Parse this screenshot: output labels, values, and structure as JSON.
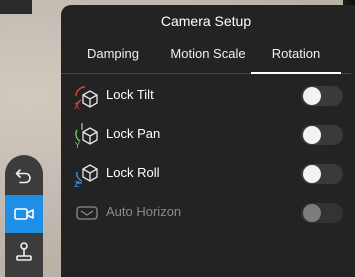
{
  "panel": {
    "title": "Camera Setup",
    "tabs": [
      {
        "label": "Damping",
        "selected": false
      },
      {
        "label": "Motion Scale",
        "selected": false
      },
      {
        "label": "Rotation",
        "selected": true
      }
    ],
    "rows": [
      {
        "label": "Lock Tilt",
        "icon": "lock-tilt-icon",
        "axis": "X",
        "on": false,
        "enabled": true
      },
      {
        "label": "Lock Pan",
        "icon": "lock-pan-icon",
        "axis": "Y",
        "on": false,
        "enabled": true
      },
      {
        "label": "Lock Roll",
        "icon": "lock-roll-icon",
        "axis": "Z",
        "on": false,
        "enabled": true
      },
      {
        "label": "Auto Horizon",
        "icon": "auto-horizon-icon",
        "on": false,
        "enabled": false
      }
    ]
  },
  "toolbar": {
    "buttons": [
      {
        "icon": "undo-icon",
        "active": false
      },
      {
        "icon": "camera-icon",
        "active": true
      },
      {
        "icon": "joystick-icon",
        "active": false
      }
    ]
  },
  "colors": {
    "accent": "#1e8fe6",
    "panel_bg": "#232323",
    "axis_x": "#e2463c",
    "axis_y": "#6fd160",
    "axis_z": "#3d8ee0"
  }
}
